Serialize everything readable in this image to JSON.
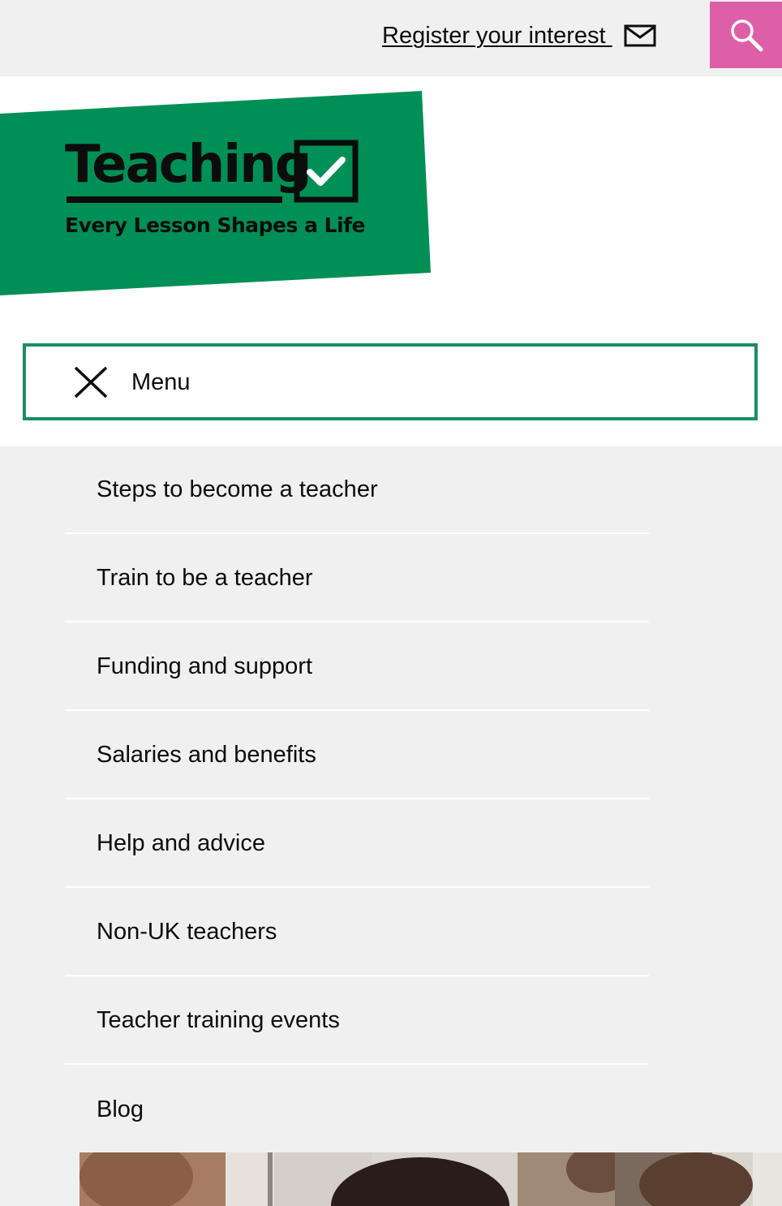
{
  "header": {
    "register_label": "Register your interest ",
    "mail_icon": "envelope-icon",
    "search_icon": "magnifier-icon",
    "search_color": "#dd5fa8",
    "background": "#f0f0f0"
  },
  "logo": {
    "wordmark": "Teaching",
    "tagline": "Every Lesson Shapes a Life",
    "brand_color": "#008f55",
    "check_icon": "checkbox-tick-icon"
  },
  "menu": {
    "label": "Menu",
    "close_icon": "close-x-icon",
    "border_color": "#1d8c5f"
  },
  "nav": {
    "items": [
      {
        "label": "Steps to become a teacher"
      },
      {
        "label": "Train to be a teacher"
      },
      {
        "label": "Funding and support"
      },
      {
        "label": "Salaries and benefits"
      },
      {
        "label": "Help and advice"
      },
      {
        "label": "Non-UK teachers"
      },
      {
        "label": "Teacher training events"
      },
      {
        "label": "Blog"
      }
    ]
  }
}
